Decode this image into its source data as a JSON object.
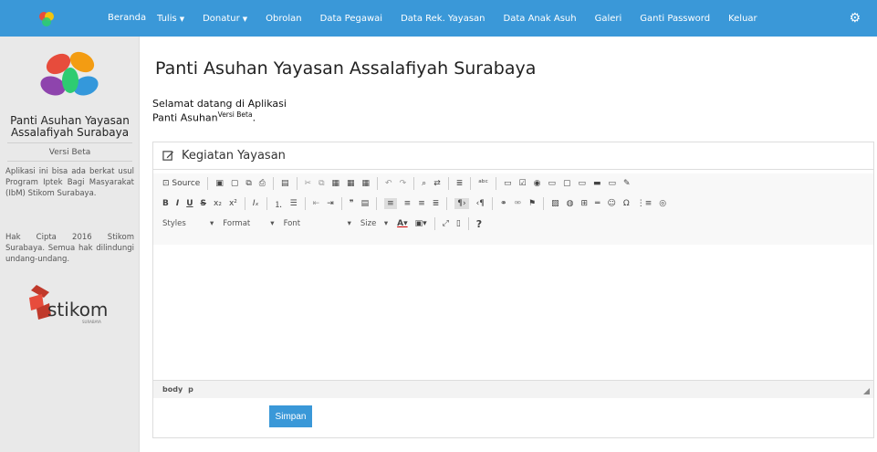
{
  "nav": {
    "home": "Beranda",
    "items": [
      {
        "label": "Tulis",
        "dropdown": true
      },
      {
        "label": "Donatur",
        "dropdown": true
      },
      {
        "label": "Obrolan",
        "dropdown": false
      },
      {
        "label": "Data Pegawai",
        "dropdown": false
      },
      {
        "label": "Data Rek. Yayasan",
        "dropdown": false
      },
      {
        "label": "Data Anak Asuh",
        "dropdown": false
      },
      {
        "label": "Galeri",
        "dropdown": false
      },
      {
        "label": "Ganti Password",
        "dropdown": false
      },
      {
        "label": "Keluar",
        "dropdown": false
      }
    ],
    "caret": "▼",
    "settings_icon": "gear-icon",
    "color": "#3a98d8"
  },
  "sidebar": {
    "title": "Panti Asuhan Yayasan Assalafiyah Surabaya",
    "version": "Versi Beta",
    "description": "Aplikasi ini bisa ada berkat usul Program Iptek Bagi Masyarakat (IbM) Stikom Surabaya.",
    "copyright": "Hak Cipta 2016 Stikom Surabaya. Semua hak dilindungi undang-undang.",
    "stikom_text": "stikom",
    "stikom_sub": "SURABAYA"
  },
  "main": {
    "title": "Panti Asuhan Yayasan Assalafiyah Surabaya",
    "welcome_line1": "Selamat datang di Aplikasi",
    "welcome_line2": "Panti Asuhan",
    "welcome_sup": "Versi Beta",
    "welcome_end": ".",
    "panel_title": "Kegiatan Yayasan",
    "toolbar": {
      "source": "Source",
      "styles": "Styles",
      "format": "Format",
      "font": "Font",
      "size": "Size",
      "help": "?"
    },
    "status": [
      "body",
      "p"
    ],
    "save_label": "Simpan"
  }
}
